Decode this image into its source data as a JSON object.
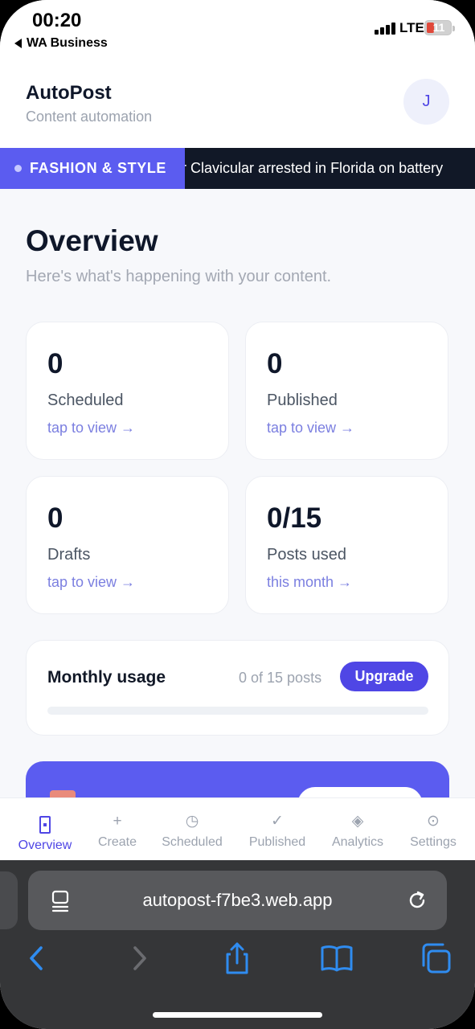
{
  "status_bar": {
    "time": "00:20",
    "back_app": "WA Business",
    "network": "LTE",
    "battery": "11"
  },
  "header": {
    "title": "AutoPost",
    "subtitle": "Content automation",
    "avatar_initial": "J"
  },
  "ticker": {
    "category": "FASHION & STYLE",
    "headline": "r Clavicular arrested in Florida on battery"
  },
  "overview": {
    "title": "Overview",
    "subtitle": "Here's what's happening with your content."
  },
  "stats": [
    {
      "value": "0",
      "label": "Scheduled",
      "link": "tap to view →"
    },
    {
      "value": "0",
      "label": "Published",
      "link": "tap to view →"
    },
    {
      "value": "0",
      "label": "Drafts",
      "link": "tap to view →"
    },
    {
      "value": "0/15",
      "label": "Posts used",
      "link": "this month →"
    }
  ],
  "usage": {
    "label": "Monthly usage",
    "count": "0 of 15 posts",
    "upgrade_label": "Upgrade",
    "progress_fraction": 0
  },
  "tabs": [
    {
      "icon": "overview-icon",
      "label": "Overview",
      "active": true
    },
    {
      "icon": "plus-icon",
      "label": "Create",
      "active": false
    },
    {
      "icon": "clock-icon",
      "label": "Scheduled",
      "active": false
    },
    {
      "icon": "check-icon",
      "label": "Published",
      "active": false
    },
    {
      "icon": "diamond-icon",
      "label": "Analytics",
      "active": false
    },
    {
      "icon": "gear-icon",
      "label": "Settings",
      "active": false
    }
  ],
  "browser": {
    "url": "autopost-f7be3.web.app"
  },
  "colors": {
    "accent": "#4f46e5",
    "ticker_tag": "#5b5cf0",
    "ticker_bg": "#111827",
    "safari_icon": "#2f8cf0"
  }
}
